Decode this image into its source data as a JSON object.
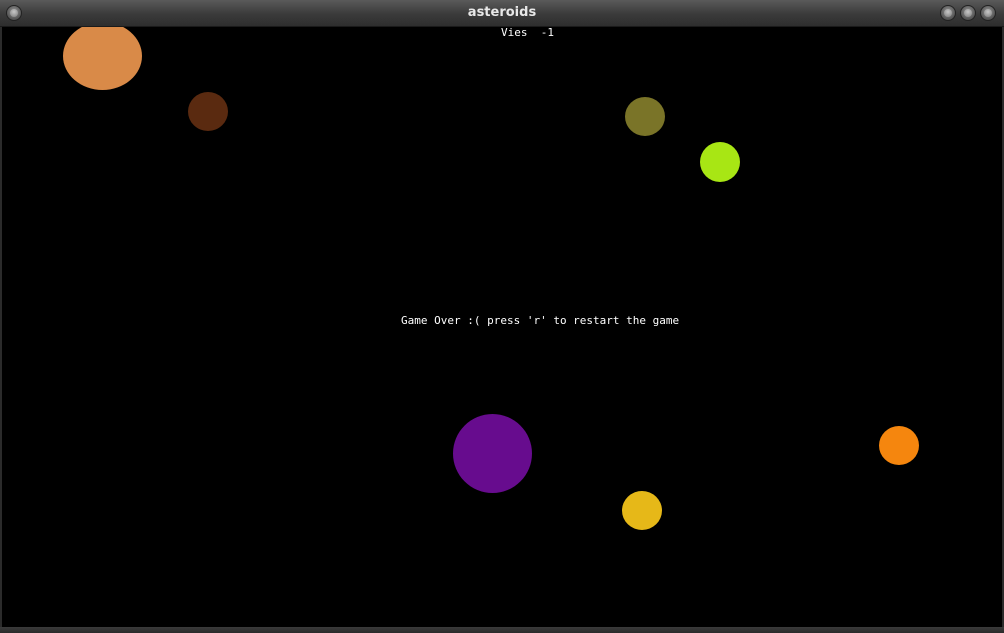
{
  "window": {
    "title": "asteroids"
  },
  "hud": {
    "lives_label": "Vies",
    "lives_value": "-1",
    "lives_text": "Vies  -1"
  },
  "game": {
    "message": "Game Over :( press 'r' to restart the game",
    "state": "game-over"
  },
  "asteroids": [
    {
      "color": "#d98a48"
    },
    {
      "color": "#5a2a10"
    },
    {
      "color": "#7a7428"
    },
    {
      "color": "#a8e614"
    },
    {
      "color": "#670c8e"
    },
    {
      "color": "#e6b818"
    },
    {
      "color": "#f5860e"
    }
  ]
}
